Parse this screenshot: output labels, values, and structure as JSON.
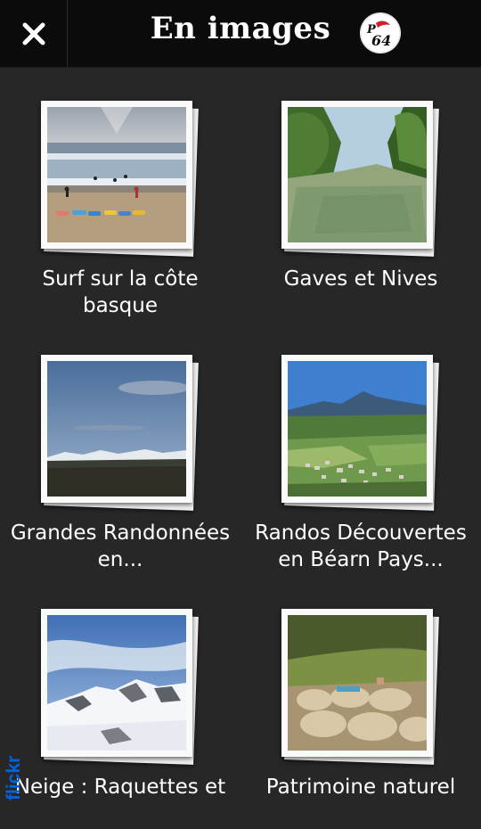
{
  "header": {
    "title": "En images",
    "close_icon": "close-icon",
    "logo_text": "P64"
  },
  "gallery": {
    "items": [
      {
        "label": "Surf sur la côte basque",
        "photo": "beach-surf"
      },
      {
        "label": "Gaves et Nives",
        "photo": "river"
      },
      {
        "label": "Grandes Randonnées en...",
        "photo": "mountain-view"
      },
      {
        "label": "Randos Découvertes en Béarn Pays...",
        "photo": "valley-village"
      },
      {
        "label": "Neige : Raquettes et",
        "photo": "snow-mountains"
      },
      {
        "label": "Patrimoine naturel",
        "photo": "sheep-field"
      }
    ]
  },
  "footer": {
    "flickr_text": "flickr"
  },
  "colors": {
    "background": "#272727",
    "topbar": "#0b0b0b",
    "frame": "#fafafa",
    "flickr_blue": "#0063dc",
    "flickr_pink": "#ff0084"
  }
}
